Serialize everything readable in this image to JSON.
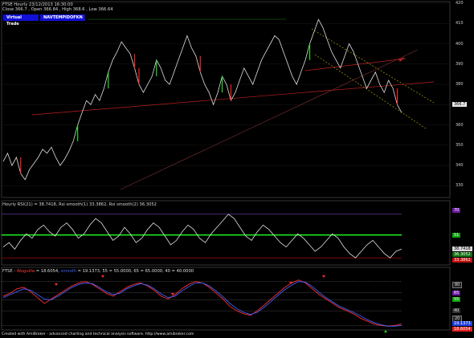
{
  "main_chart": {
    "title_line": "FTSE  Hourly  23/12/2013 16:30:00",
    "ohlc_line": "Close 366.7 , Open 366.84 , High 368.6 , Low 366.64",
    "buttons": [
      "Virtual Trade",
      "NAVTEMPIDOFKN"
    ],
    "y_ticks": [
      "420",
      "410",
      "400",
      "390",
      "380",
      "370",
      "360",
      "350",
      "340",
      "330"
    ],
    "price_tag": "366.7"
  },
  "rsi_panel": {
    "title_line": "Hourly RSI(21) = 38.7418, Rsi smooth(1) 33.3862, Rsi smooth(2) 36.3052",
    "upper_tag": "70",
    "mid_tag": "51",
    "tags": [
      "38.7418",
      "36.3052",
      "33.3862"
    ]
  },
  "osc_panel": {
    "title_parts": [
      {
        "text": "FTSE - ",
        "color": "#dddddd"
      },
      {
        "text": "Wuguilla",
        "color": "#ff4040"
      },
      {
        "text": " = 18.6054, ",
        "color": "#dddddd"
      },
      {
        "text": "smooth",
        "color": "#4060ff"
      },
      {
        "text": " = 19.1373, 55 = 55.0000, 65 = 65.0000, 40 = 40.0000",
        "color": "#dddddd"
      }
    ],
    "level_tags": [
      "80",
      "65",
      "55",
      "40",
      "20"
    ],
    "value_tags": [
      "19.1373",
      "18.6054"
    ]
  },
  "footer": "Created with AmiBroker - advanced charting and technical analysis software. http://www.amibroker.com",
  "colors": {
    "background": "#000000",
    "price": "#e0e0e0",
    "up_candle": "#20e020",
    "down_candle": "#ff2020",
    "trendline": "#c02020",
    "channel": "#c8b400",
    "rsi_mid": "#20ff20",
    "osc_red": "#ff3030",
    "osc_blue": "#4060ff"
  },
  "chart_data": [
    {
      "type": "line",
      "title": "FTSE Hourly",
      "ylim": [
        325,
        420
      ],
      "y_ticks": [
        420,
        410,
        400,
        390,
        380,
        370,
        360,
        350,
        340,
        330
      ],
      "series": [
        {
          "name": "FTSE",
          "values": [
            342,
            346,
            340,
            344,
            336,
            333,
            338,
            341,
            344,
            348,
            346,
            349,
            344,
            340,
            343,
            347,
            352,
            360,
            366,
            372,
            370,
            375,
            372,
            378,
            386,
            392,
            396,
            401,
            398,
            395,
            388,
            380,
            376,
            380,
            384,
            392,
            388,
            382,
            380,
            386,
            392,
            398,
            404,
            398,
            394,
            386,
            380,
            376,
            370,
            376,
            384,
            380,
            372,
            376,
            382,
            388,
            384,
            380,
            386,
            392,
            396,
            400,
            404,
            402,
            396,
            390,
            384,
            380,
            386,
            392,
            400,
            406,
            412,
            408,
            402,
            396,
            392,
            388,
            394,
            400,
            396,
            390,
            384,
            378,
            382,
            386,
            380,
            376,
            382,
            378,
            370,
            366
          ]
        }
      ]
    },
    {
      "type": "line",
      "title": "Hourly RSI(21)",
      "ylim": [
        25,
        75
      ],
      "series": [
        {
          "name": "RSI",
          "values": [
            40,
            44,
            38,
            46,
            52,
            48,
            56,
            60,
            54,
            50,
            58,
            62,
            56,
            48,
            52,
            60,
            66,
            62,
            54,
            46,
            50,
            58,
            52,
            44,
            48,
            56,
            62,
            58,
            50,
            42,
            46,
            54,
            60,
            56,
            48,
            44,
            52,
            58,
            64,
            70,
            66,
            58,
            50,
            46,
            54,
            60,
            56,
            50,
            44,
            40,
            46,
            52,
            48,
            42,
            36,
            40,
            46,
            52,
            48,
            40,
            34,
            30,
            36,
            42,
            46,
            40,
            34,
            30,
            36,
            38
          ]
        }
      ]
    },
    {
      "type": "line",
      "title": "FTSE oscillator",
      "ylim": [
        15,
        85
      ],
      "series": [
        {
          "name": "Wuguilla",
          "values": [
            60,
            64,
            70,
            72,
            66,
            58,
            50,
            56,
            62,
            68,
            74,
            78,
            80,
            76,
            70,
            64,
            60,
            66,
            72,
            76,
            78,
            74,
            68,
            60,
            56,
            62,
            70,
            76,
            80,
            78,
            72,
            64,
            56,
            46,
            40,
            36,
            34,
            40,
            48,
            56,
            64,
            72,
            78,
            82,
            78,
            70,
            62,
            56,
            50,
            44,
            40,
            36,
            30,
            26,
            22,
            20,
            19,
            20,
            22
          ]
        },
        {
          "name": "smooth",
          "values": [
            58,
            62,
            66,
            70,
            68,
            62,
            56,
            55,
            60,
            66,
            72,
            76,
            78,
            77,
            72,
            66,
            62,
            64,
            70,
            74,
            77,
            75,
            70,
            63,
            58,
            60,
            67,
            73,
            78,
            78,
            74,
            67,
            59,
            50,
            43,
            38,
            35,
            38,
            45,
            53,
            61,
            69,
            75,
            80,
            79,
            73,
            65,
            58,
            52,
            46,
            42,
            38,
            33,
            28,
            24,
            21,
            19,
            19,
            20
          ]
        }
      ]
    }
  ]
}
